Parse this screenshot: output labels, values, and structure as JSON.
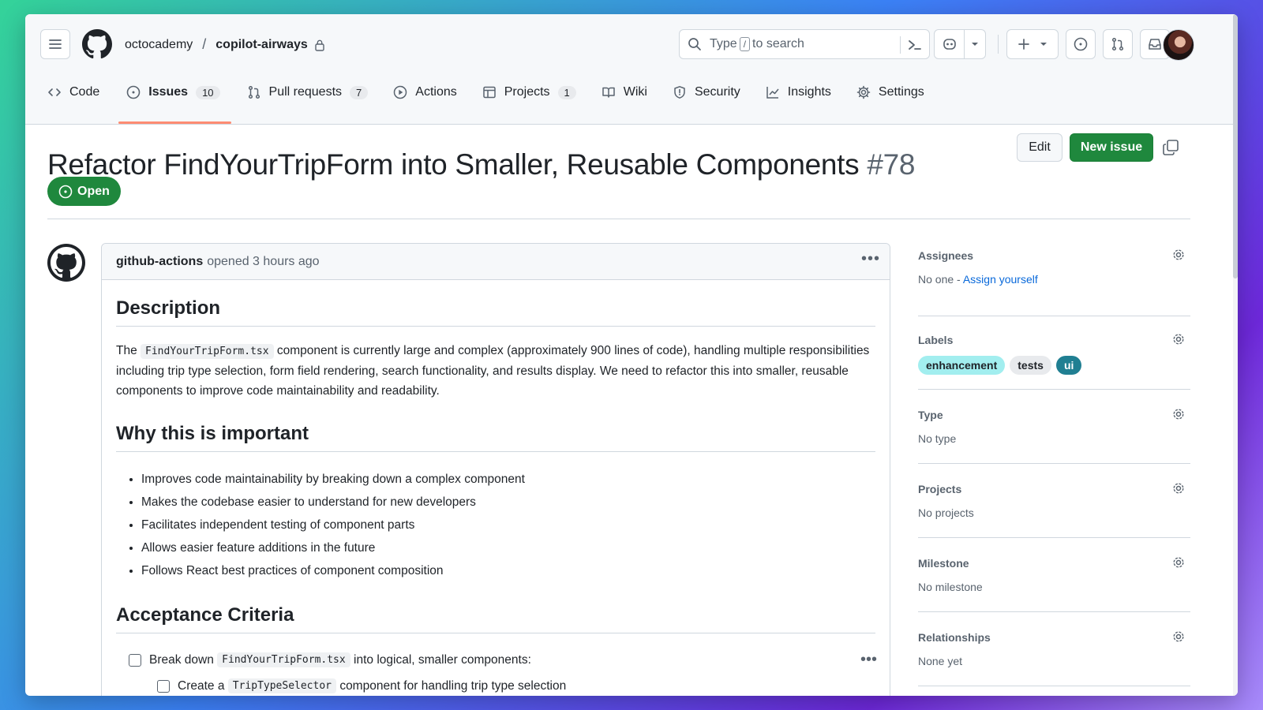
{
  "header": {
    "owner": "octocademy",
    "separator": "/",
    "repo": "copilot-airways",
    "search_prefix": "Type",
    "search_key": "/",
    "search_suffix": "to search"
  },
  "tabs": [
    {
      "label": "Code",
      "icon": "code-icon"
    },
    {
      "label": "Issues",
      "count": "10",
      "icon": "issue-icon",
      "selected": true
    },
    {
      "label": "Pull requests",
      "count": "7",
      "icon": "pull-request-icon"
    },
    {
      "label": "Actions",
      "icon": "play-icon"
    },
    {
      "label": "Projects",
      "count": "1",
      "icon": "table-icon"
    },
    {
      "label": "Wiki",
      "icon": "book-icon"
    },
    {
      "label": "Security",
      "icon": "shield-icon"
    },
    {
      "label": "Insights",
      "icon": "graph-icon"
    },
    {
      "label": "Settings",
      "icon": "gear-icon"
    }
  ],
  "issue": {
    "title": "Refactor FindYourTripForm into Smaller, Reusable Components",
    "number": "#78",
    "state": "Open",
    "edit_label": "Edit",
    "new_issue_label": "New issue"
  },
  "comment": {
    "author": "github-actions",
    "meta": "opened 3 hours ago",
    "description_heading": "Description",
    "desc_prefix": "The",
    "desc_code": "FindYourTripForm.tsx",
    "desc_rest": "component is currently large and complex (approximately 900 lines of code), handling multiple responsibilities including trip type selection, form field rendering, search functionality, and results display. We need to refactor this into smaller, reusable components to improve code maintainability and readability.",
    "why_heading": "Why this is important",
    "why_items": [
      "Improves code maintainability by breaking down a complex component",
      "Makes the codebase easier to understand for new developers",
      "Facilitates independent testing of component parts",
      "Allows easier feature additions in the future",
      "Follows React best practices of component composition"
    ],
    "ac_heading": "Acceptance Criteria",
    "ac_item_prefix": "Break down",
    "ac_item_code": "FindYourTripForm.tsx",
    "ac_item_suffix": "into logical, smaller components:",
    "ac_sub_prefix": "Create a",
    "ac_sub_code": "TripTypeSelector",
    "ac_sub_suffix": "component for handling trip type selection"
  },
  "sidebar": {
    "assignees": {
      "title": "Assignees",
      "value": "No one -",
      "link": "Assign yourself"
    },
    "labels": {
      "title": "Labels",
      "items": [
        {
          "name": "enhancement",
          "bg": "#a2eeef",
          "fg": "#1f2328"
        },
        {
          "name": "tests",
          "bg": "#e8eaed",
          "fg": "#1f2328"
        },
        {
          "name": "ui",
          "bg": "#207f92",
          "fg": "#ffffff"
        }
      ]
    },
    "type": {
      "title": "Type",
      "value": "No type"
    },
    "projects": {
      "title": "Projects",
      "value": "No projects"
    },
    "milestone": {
      "title": "Milestone",
      "value": "No milestone"
    },
    "relationships": {
      "title": "Relationships",
      "value": "None yet"
    }
  },
  "colors": {
    "accent_green": "#1f883d",
    "tab_underline": "#fd8c73",
    "link_blue": "#0969da"
  }
}
